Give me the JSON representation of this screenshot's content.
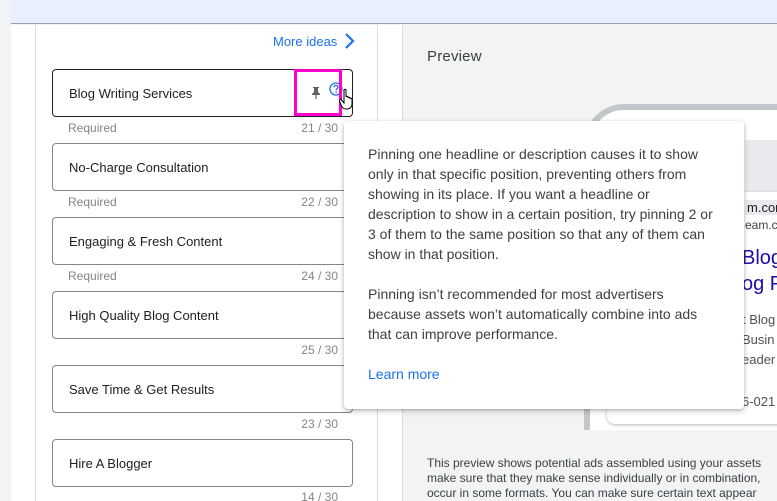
{
  "editor": {
    "more_ideas_label": "More ideas",
    "headlines": [
      {
        "value": "Blog Writing Services",
        "helper": "Required",
        "count": "21 / 30"
      },
      {
        "value": "No-Charge Consultation",
        "helper": "Required",
        "count": "22 / 30"
      },
      {
        "value": "Engaging & Fresh Content",
        "helper": "Required",
        "count": "24 / 30"
      },
      {
        "value": "High Quality Blog Content",
        "helper": "",
        "count": "25 / 30"
      },
      {
        "value": "Save Time & Get Results",
        "helper": "",
        "count": "23 / 30"
      },
      {
        "value": "Hire A Blogger",
        "helper": "",
        "count": "14 / 30"
      }
    ]
  },
  "preview": {
    "title": "Preview",
    "ad": {
      "display_url": "m.cor",
      "display_url_2": "eam.c",
      "headline_1": "Blog",
      "headline_2": "og P",
      "desc_1": "t Blog",
      "desc_2": "Busin",
      "desc_3": "eader",
      "phone": "6-021"
    },
    "note_lines": [
      "This preview shows potential ads assembled using your assets",
      "make sure that they make sense individually or in combination,",
      "occur in some formats. You can make sure certain text appear"
    ]
  },
  "tooltip": {
    "paragraph_1": "Pinning one headline or description causes it to show only in that specific position, preventing others from showing in its place. If you want a headline or description to show in a certain position, try pinning 2 or 3 of them to the same position so that any of them can show in that position.",
    "paragraph_2": "Pinning isn’t recommended for most advertisers because assets won’t automatically combine into ads that can improve performance.",
    "learn_more_label": "Learn more"
  },
  "colors": {
    "accent": "#1a73e8",
    "highlight": "#ff00cc",
    "top_bar": "#e8f0fe"
  }
}
